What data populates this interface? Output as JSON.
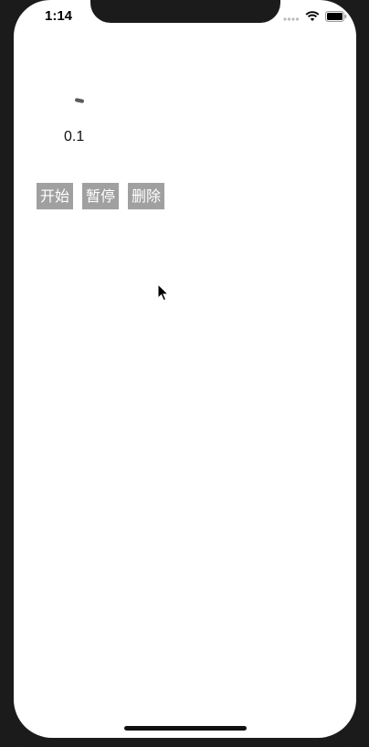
{
  "status_bar": {
    "time": "1:14",
    "icons": [
      "signal-icon",
      "wifi-icon",
      "battery-icon"
    ]
  },
  "progress": {
    "label": "0.1",
    "value": 0.1
  },
  "buttons": {
    "start_label": "开始",
    "pause_label": "暂停",
    "delete_label": "删除"
  },
  "colors": {
    "button_bg": "#a0a0a0",
    "button_text": "#ffffff",
    "screen_bg": "#ffffff",
    "bezel": "#1b1b1b"
  }
}
